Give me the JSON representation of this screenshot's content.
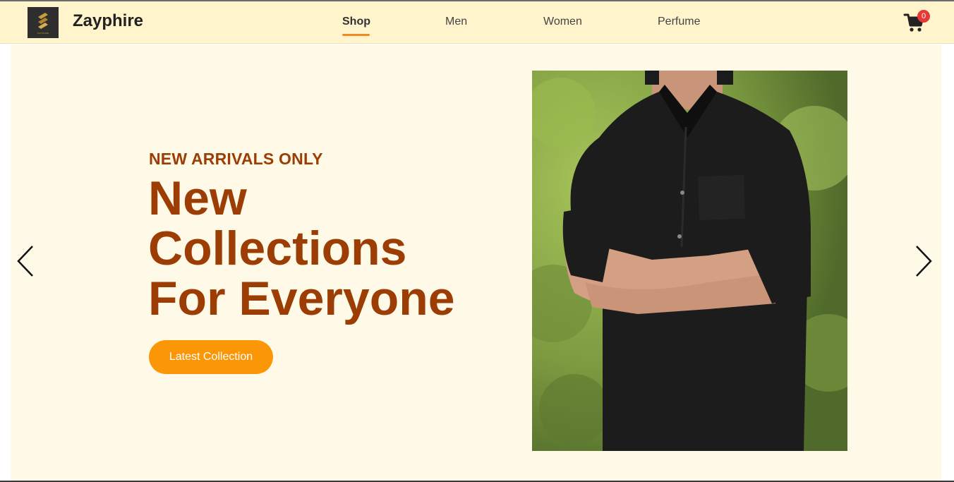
{
  "brand": {
    "name": "Zayphire",
    "logo_tagline": "ZAYPHIRE"
  },
  "nav": {
    "items": [
      {
        "label": "Shop",
        "active": true
      },
      {
        "label": "Men",
        "active": false
      },
      {
        "label": "Women",
        "active": false
      },
      {
        "label": "Perfume",
        "active": false
      }
    ]
  },
  "cart": {
    "icon": "shopping-cart-icon",
    "count": "0"
  },
  "hero": {
    "eyebrow": "NEW ARRIVALS ONLY",
    "headline_lines": [
      "New",
      "Collections",
      "For Everyone"
    ],
    "cta_label": "Latest Collection",
    "prev_icon": "chevron-left-icon",
    "next_icon": "chevron-right-icon"
  },
  "colors": {
    "navbar_bg": "#fff4cc",
    "hero_bg": "#fffae7",
    "headline": "#9b3d04",
    "cta_bg": "#fb9607",
    "accent_underline": "#f08b1f",
    "badge_bg": "#e53935"
  }
}
